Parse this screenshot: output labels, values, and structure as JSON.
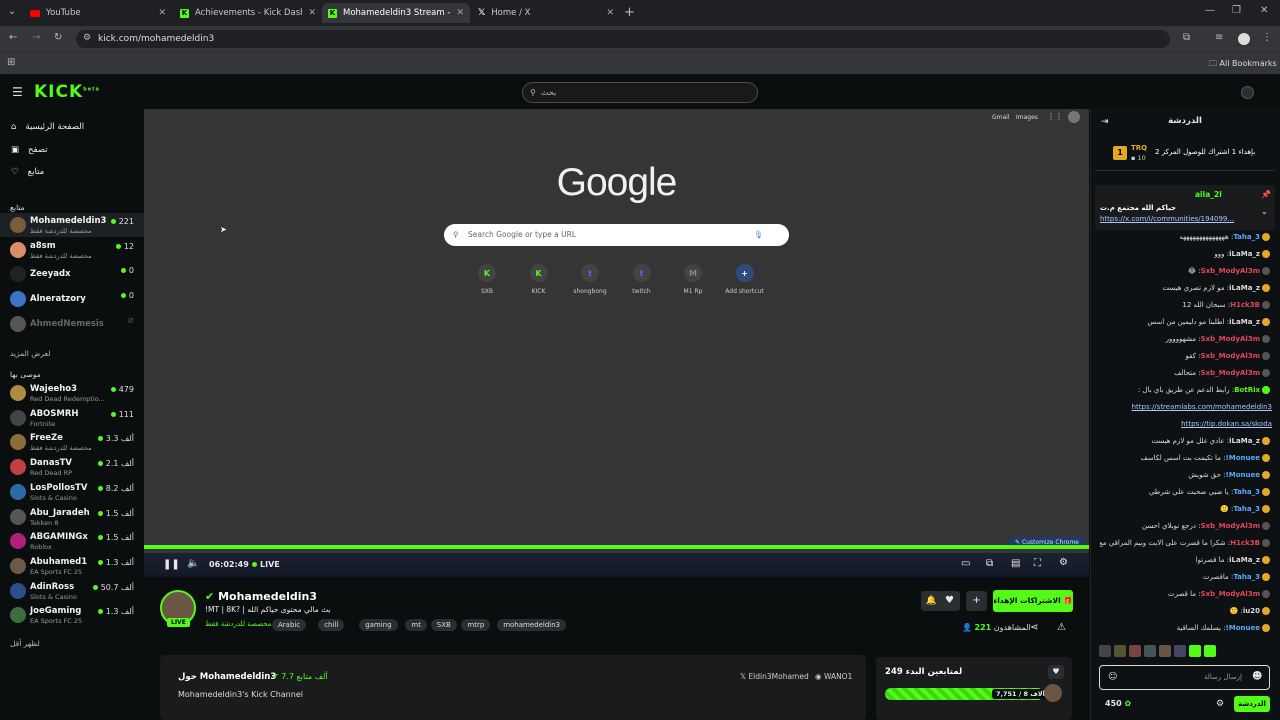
{
  "browser": {
    "tabs": [
      {
        "title": "YouTube",
        "favicon": "youtube",
        "active": false
      },
      {
        "title": "Achievements - Kick Dashboard",
        "favicon": "kick",
        "active": false
      },
      {
        "title": "Mohamedeldin3 Stream - Wat...",
        "favicon": "kick",
        "active": true
      },
      {
        "title": "Home / X",
        "favicon": "x",
        "active": false
      }
    ],
    "url": "kick.com/mohamedeldin3",
    "all_bookmarks": "All Bookmarks"
  },
  "kick": {
    "logo": "KICK",
    "logo_badge": "beta",
    "search_placeholder": "بحث"
  },
  "sidebar": {
    "nav": [
      {
        "label": "الصفحة الرئيسية",
        "icon": "home-icon"
      },
      {
        "label": "تصفح",
        "icon": "browse-icon"
      },
      {
        "label": "متابع",
        "icon": "heart-icon"
      }
    ],
    "following_header": "متابع",
    "following": [
      {
        "name": "Mohamedeldin3",
        "sub": "مخصصة للدردشة فقط",
        "viewers": "221",
        "color": "#7a5b3a"
      },
      {
        "name": "a8sm",
        "sub": "مخصصة للدردشة فقط",
        "viewers": "12",
        "color": "#d98e6a"
      },
      {
        "name": "Zeeyadx",
        "sub": "",
        "viewers": "0",
        "color": "#222"
      },
      {
        "name": "Alneratzory",
        "sub": "",
        "viewers": "0",
        "color": "#3a74c4"
      },
      {
        "name": "AhmedNemesis",
        "sub": "",
        "viewers": "",
        "color": "#555"
      }
    ],
    "show_more": "لعرض المزيد",
    "recommended_header": "موصى بها",
    "recommended": [
      {
        "name": "Wajeeho3",
        "sub": "Red Dead Redemptio...",
        "viewers": "479",
        "color": "#b08a3e"
      },
      {
        "name": "ABOSMRH",
        "sub": "Fortnite",
        "viewers": "111",
        "color": "#444"
      },
      {
        "name": "FreeZe",
        "sub": "مخصصة للدردشة فقط",
        "viewers": "3.3 ألف",
        "color": "#8a6d3c"
      },
      {
        "name": "DanasTV",
        "sub": "Red Dead RP",
        "viewers": "2.1 ألف",
        "color": "#c24040"
      },
      {
        "name": "LosPollosTV",
        "sub": "Slots & Casino",
        "viewers": "8.2 ألف",
        "color": "#2d6aa8"
      },
      {
        "name": "Abu_Jaradeh",
        "sub": "Tekken 8",
        "viewers": "1.5 ألف",
        "color": "#555"
      },
      {
        "name": "ABGAMINGx",
        "sub": "Roblox",
        "viewers": "1.5 ألف",
        "color": "#b0207a"
      },
      {
        "name": "Abuhamed1",
        "sub": "EA Sports FC 25",
        "viewers": "1.3 ألف",
        "color": "#6b5a48"
      },
      {
        "name": "AdinRoss",
        "sub": "Slots & Casino",
        "viewers": "50.7 ألف",
        "color": "#2b4e8c"
      },
      {
        "name": "JoeGaming",
        "sub": "EA Sports FC 25",
        "viewers": "1.3 ألف",
        "color": "#3c6d3c"
      }
    ],
    "show_less": "لظهر أقل"
  },
  "player": {
    "google_top": {
      "gmail": "Gmail",
      "images": "Images"
    },
    "google_logo": "Google",
    "google_search_placeholder": "Search Google or type a URL",
    "shortcuts": [
      {
        "label": "SXB",
        "glyph": "K"
      },
      {
        "label": "KICK",
        "glyph": "K"
      },
      {
        "label": "shongbong",
        "glyph": "t"
      },
      {
        "label": "twitch",
        "glyph": "t"
      },
      {
        "label": "M1 Rp",
        "glyph": "M"
      },
      {
        "label": "Add shortcut",
        "glyph": "+"
      }
    ],
    "customize": "Customize Chrome",
    "time": "06:02:49",
    "live": "LIVE"
  },
  "stream": {
    "channel": "Mohamedeldin3",
    "title": "!MT | 8K? | بث مالي محتوى حياكم الله",
    "chat_mode": "مخصصة للدردشة فقط",
    "tags": [
      "Arabic",
      "chill",
      "gaming",
      "mt",
      "SXB",
      "mtrp",
      "mohamedeldin3"
    ],
    "viewers": "221",
    "viewers_label": "المشاهدون",
    "gift_button": "الاشتراكات الإهداء",
    "live_badge": "LIVE"
  },
  "about": {
    "heading": "حول Mohamedeldin3",
    "followers": "7.7 ألف متابع",
    "description": "Mohamedeldin3's Kick Channel",
    "socials": [
      "Eldin3Mohamed",
      "WANO1"
    ]
  },
  "leaderboard": {
    "title": "لمتابعين البدء 249",
    "progress_text": "7,751 / 8 آلاف",
    "progress": 0.97
  },
  "chat": {
    "header": "الدردشة",
    "pinned_user": "TRQ",
    "pinned_count": "10",
    "pinned_text": "بإهداء 1 اشتراك للوصول المركز 2",
    "pinned_msg_user": "aila_2l",
    "pinned_msg_text": "حياكم الله مجتمع م.ت",
    "pinned_link": "https://x.com/i/communities/194099...",
    "messages": [
      {
        "user": "Taha_3",
        "text": "ههههههههههههههه",
        "cls": "blue"
      },
      {
        "user": "iLaMa_z",
        "text": "ووو",
        "cls": ""
      },
      {
        "user": "Sxb_ModyAl3m",
        "text": "😂",
        "cls": "red"
      },
      {
        "user": "iLaMa_z",
        "text": "مو لازم تصري هيست",
        "cls": ""
      },
      {
        "user": "H1ck3B",
        "text": "سبحان الله 12",
        "cls": "red"
      },
      {
        "user": "iLaMa_z",
        "text": "اطلبنا مو دليمين من اسس",
        "cls": ""
      },
      {
        "user": "Sxb_ModyAl3m",
        "text": "مشهوووور",
        "cls": "red"
      },
      {
        "user": "Sxb_ModyAl3m",
        "text": "كفو",
        "cls": "red"
      },
      {
        "user": "Sxb_ModyAl3m",
        "text": "متحالف",
        "cls": "red"
      },
      {
        "user": "BotRix",
        "text": "رابط الدعم عن طريق باي بال :",
        "cls": "green"
      },
      {
        "user": "",
        "text": "https://streamlabs.com/mohamedeldin3",
        "cls": "link"
      },
      {
        "user": "",
        "text": "https://tip.dokan.sa/skoda",
        "cls": "link"
      },
      {
        "user": "iLaMa_z",
        "text": "عادي غلل مو لازم هيست",
        "cls": ""
      },
      {
        "user": "Monuee!",
        "text": "ما تكيمت بت اسس لكاسف",
        "cls": "blue"
      },
      {
        "user": "Monuee!",
        "text": "حق شويش",
        "cls": "blue"
      },
      {
        "user": "Taha_3",
        "text": "يا ضيي صحبت علي شرطي",
        "cls": "blue"
      },
      {
        "user": "Taha_3",
        "text": "🙂",
        "cls": "blue"
      },
      {
        "user": "Sxb_ModyAl3m",
        "text": "درجع نوبلاي احسن",
        "cls": "red"
      },
      {
        "user": "H1ck3B",
        "text": "شكرا ما قصرت على الايت ونيم المراقي مع",
        "cls": "red"
      },
      {
        "user": "iLaMa_z",
        "text": "ما قصرتوا",
        "cls": ""
      },
      {
        "user": "Taha_3",
        "text": "ماقصرت",
        "cls": "blue"
      },
      {
        "user": "Sxb_ModyAl3m",
        "text": "ما قصرت",
        "cls": "red"
      },
      {
        "user": "iu20",
        "text": "🙂",
        "cls": ""
      },
      {
        "user": "Monuee!",
        "text": "يسلمك الساقية",
        "cls": "blue"
      }
    ],
    "input_placeholder": "إرسال رسالة",
    "send_button": "الدردشة",
    "points": "450"
  }
}
